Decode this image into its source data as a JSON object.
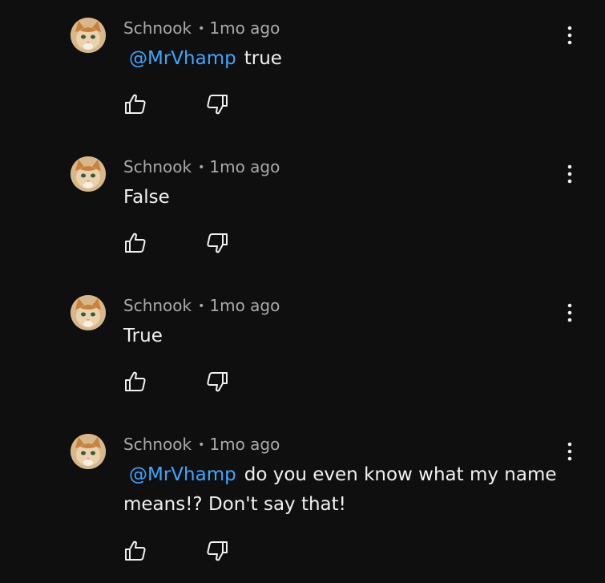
{
  "colors": {
    "background": "#0f0f0f",
    "text": "#f1f1f1",
    "meta": "#aaaaaa",
    "mention": "#3ea6ff"
  },
  "icons": {
    "like": "thumb-up-icon",
    "dislike": "thumb-down-icon",
    "menu": "more-vertical-icon",
    "avatar": "cat-avatar"
  },
  "comments": [
    {
      "author": "Schnook",
      "separator": "•",
      "time": "1mo ago",
      "mention": "@MrVhamp",
      "text": "true"
    },
    {
      "author": "Schnook",
      "separator": "•",
      "time": "1mo ago",
      "mention": "",
      "text": "False"
    },
    {
      "author": "Schnook",
      "separator": "•",
      "time": "1mo ago",
      "mention": "",
      "text": "True"
    },
    {
      "author": "Schnook",
      "separator": "•",
      "time": "1mo ago",
      "mention": "@MrVhamp",
      "text": "do you even know what my name means!? Don't say that!"
    }
  ]
}
